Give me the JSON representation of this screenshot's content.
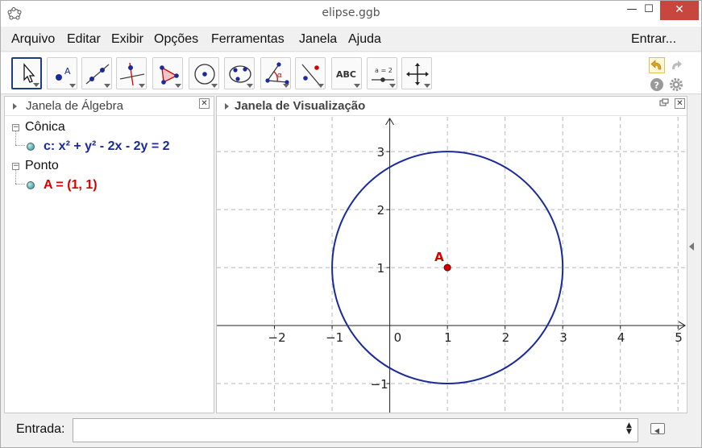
{
  "window": {
    "title": "elipse.ggb",
    "minimize_label": "—",
    "maximize_label": "☐",
    "close_label": "✕"
  },
  "menu": {
    "items": [
      "Arquivo",
      "Editar",
      "Exibir",
      "Opções",
      "Ferramentas",
      "Janela",
      "Ajuda"
    ],
    "signin_label": "Entrar..."
  },
  "toolbar": {
    "tools": [
      {
        "name": "move-tool-icon",
        "selected": true
      },
      {
        "name": "point-tool-icon"
      },
      {
        "name": "line-tool-icon"
      },
      {
        "name": "perpendicular-tool-icon"
      },
      {
        "name": "polygon-tool-icon"
      },
      {
        "name": "circle-tool-icon"
      },
      {
        "name": "conic-tool-icon"
      },
      {
        "name": "angle-tool-icon"
      },
      {
        "name": "reflect-tool-icon"
      },
      {
        "name": "text-tool-icon",
        "label": "ABC"
      },
      {
        "name": "slider-tool-icon",
        "label": "a = 2"
      },
      {
        "name": "move-graphics-tool-icon"
      }
    ]
  },
  "algebra": {
    "title": "Janela de Álgebra",
    "close_label": "✕",
    "groups": [
      {
        "label": "Cônica",
        "objects": [
          {
            "text": "c: x² + y² - 2x - 2y = 2",
            "color": "#1a2a9c"
          }
        ]
      },
      {
        "label": "Ponto",
        "objects": [
          {
            "text": "A = (1, 1)",
            "color": "#d40000"
          }
        ]
      }
    ]
  },
  "graphics": {
    "title": "Janela de Visualização",
    "close_label": "✕",
    "point_label": "A"
  },
  "chart_data": {
    "type": "scatter",
    "x_ticks": [
      "−2",
      "−1",
      "0",
      "1",
      "2",
      "3",
      "4",
      "5"
    ],
    "y_ticks": [
      "−1",
      "0",
      "1",
      "2",
      "3"
    ],
    "xlim": [
      -3,
      5.15
    ],
    "ylim": [
      -1.5,
      3.6
    ],
    "grid": true,
    "conic": {
      "equation": "x² + y² - 2x - 2y = 2",
      "center": [
        1,
        1
      ],
      "radius": 2,
      "color": "#1a2a9c"
    },
    "points": [
      {
        "label": "A",
        "x": 1,
        "y": 1,
        "color": "#d40000"
      }
    ]
  },
  "input": {
    "label": "Entrada:",
    "value": ""
  },
  "colors": {
    "selected_tool_border": "#1f3b86",
    "conic": "#1a2a9c",
    "point": "#d40000",
    "close_button": "#c7463d"
  }
}
